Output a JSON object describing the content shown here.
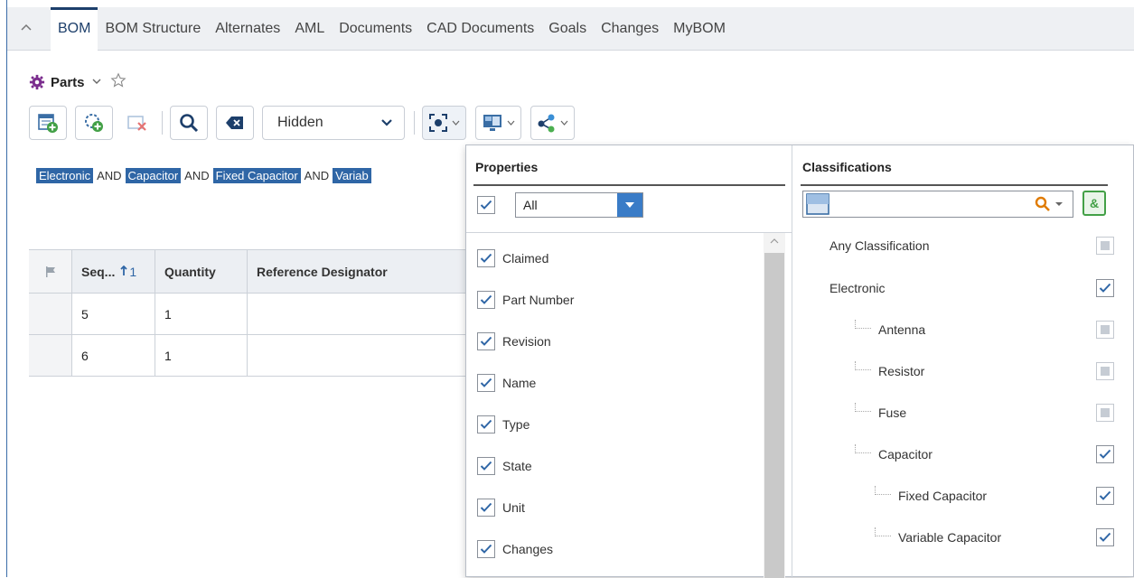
{
  "tabs": [
    "BOM",
    "BOM Structure",
    "Alternates",
    "AML",
    "Documents",
    "CAD Documents",
    "Goals",
    "Changes",
    "MyBOM"
  ],
  "title": {
    "text": "Parts"
  },
  "toolbar": {
    "display_select": "Hidden"
  },
  "filter": {
    "chips": [
      "Electronic",
      "Capacitor",
      "Fixed Capacitor",
      "Variab"
    ],
    "operator": "AND"
  },
  "grid": {
    "headers": {
      "seq": "Seq...",
      "sort_index": "1",
      "quantity": "Quantity",
      "refdes": "Reference Designator"
    },
    "rows": [
      {
        "seq": "5",
        "quantity": "1",
        "refdes": ""
      },
      {
        "seq": "6",
        "quantity": "1",
        "refdes": ""
      }
    ]
  },
  "properties": {
    "heading": "Properties",
    "filter_value": "All",
    "items": [
      "Claimed",
      "Part Number",
      "Revision",
      "Name",
      "Type",
      "State",
      "Unit",
      "Changes"
    ]
  },
  "classifications": {
    "heading": "Classifications",
    "search_placeholder": "",
    "amp_label": "&",
    "items": [
      {
        "label": "Any Classification",
        "level": 0,
        "checked": false
      },
      {
        "label": "Electronic",
        "level": 0,
        "checked": true
      },
      {
        "label": "Antenna",
        "level": 1,
        "checked": false
      },
      {
        "label": "Resistor",
        "level": 1,
        "checked": false
      },
      {
        "label": "Fuse",
        "level": 1,
        "checked": false
      },
      {
        "label": "Capacitor",
        "level": 1,
        "checked": true
      },
      {
        "label": "Fixed Capacitor",
        "level": 2,
        "checked": true
      },
      {
        "label": "Variable Capacitor",
        "level": 2,
        "checked": true
      }
    ]
  },
  "colors": {
    "accent": "#2f66a6",
    "active_tab": "#1d3f6b",
    "search_orange": "#e07b00",
    "amp_green": "#43a047"
  }
}
